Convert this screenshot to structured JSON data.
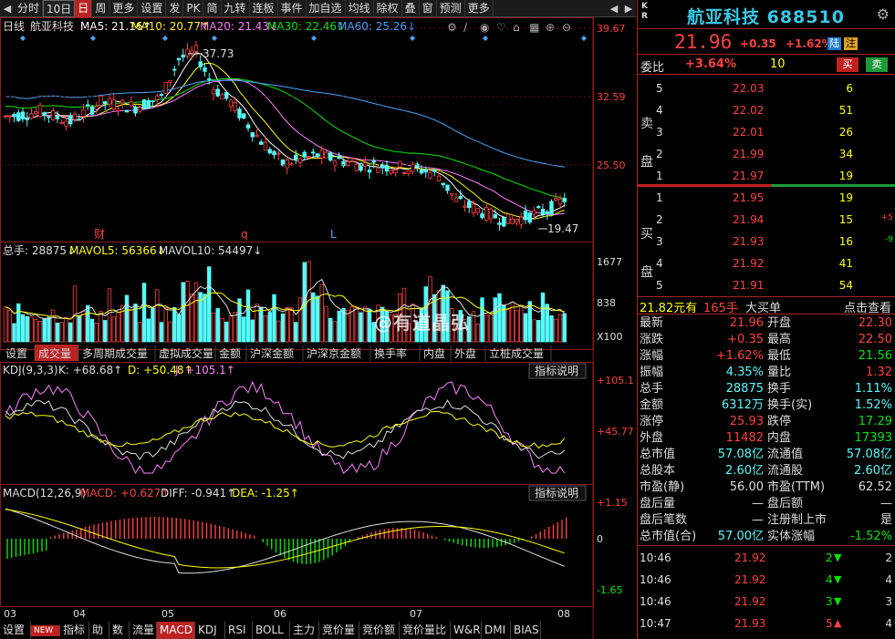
{
  "toolbar": {
    "items": [
      "分时",
      "10日",
      "日",
      "周",
      "更多",
      "设置",
      "发",
      "PK",
      "简",
      "九转",
      "连板",
      "事件",
      "加自选",
      "均线",
      "除权",
      "叠",
      "窗",
      "预测",
      "更多"
    ],
    "active": "日"
  },
  "colors": {
    "up": "#ff4040",
    "down": "#54fcfc",
    "ma5": "#ffffff",
    "ma10": "#ffff00",
    "ma20": "#ff80ff",
    "ma30": "#00e600",
    "ma60": "#4aa3ff",
    "panel_border": "#a22"
  },
  "main_panel": {
    "label": "日线",
    "name": "航亚科技",
    "ma": [
      {
        "t": "MA5: 21.16↑",
        "c": "#ffffff"
      },
      {
        "t": "MA10: 20.77↑",
        "c": "#ffff00"
      },
      {
        "t": "MA20: 21.43↓",
        "c": "#ff80ff"
      },
      {
        "t": "MA30: 22.46↓",
        "c": "#00e600"
      },
      {
        "t": "MA60: 25.26↓",
        "c": "#4aa3ff"
      }
    ],
    "y_labels": [
      "39.67",
      "32.59",
      "25.50"
    ],
    "high_label": "37.73",
    "low_label": "19.47",
    "markers": [
      "财",
      "q",
      "L"
    ]
  },
  "volume_panel": {
    "label": "总手: 28875↓",
    "mav5": "MAVOL5: 56366↓",
    "mav10": "MAVOL10: 54497↓",
    "y_labels": [
      "1677",
      "838",
      "X100"
    ],
    "tabs": [
      "设置",
      "成交量",
      "多周期成交量",
      "虚拟成交量",
      "金额",
      "沪深金额",
      "沪深京金额",
      "换手率",
      "内盘",
      "外盘",
      "立桩成交量"
    ],
    "active_tab": "成交量"
  },
  "kdj_panel": {
    "label": "KDJ(9,3,3)",
    "k": "K: +68.68↑",
    "d": "D: +50.48↑",
    "j": "J: +105.1↑",
    "btn": "指标说明",
    "y_labels": [
      "+105.1",
      "+45.77"
    ]
  },
  "macd_panel": {
    "label": "MACD(12,26,9)",
    "macd": "MACD: +0.627↑",
    "diff": "DIFF: -0.941↑",
    "dea": "DEA: -1.25↑",
    "btn": "指标说明",
    "y_labels": [
      "+1.15",
      "0",
      "-1.65"
    ]
  },
  "x_labels": [
    "03",
    "04",
    "05",
    "06",
    "07",
    "08"
  ],
  "bottom_tabs": [
    "设置",
    "NEW",
    "指标",
    "助",
    "数",
    "流量",
    "MACD",
    "KDJ",
    "RSI",
    "BOLL",
    "主力",
    "竞价量",
    "竞价额",
    "竞价量比",
    "W&R",
    "DMI",
    "BIAS"
  ],
  "bottom_active": "MACD",
  "stock": {
    "kr": "K R",
    "name": "航亚科技 688510",
    "price": "21.96",
    "change": "+0.35",
    "pct": "+1.62%",
    "tag1": "陆",
    "tag2": "注"
  },
  "weibi": {
    "label": "委比",
    "value": "+3.64%",
    "vol": "10",
    "buy": "买",
    "sell": "卖"
  },
  "sell_book": [
    {
      "n": "5",
      "p": "22.03",
      "v": "6"
    },
    {
      "n": "4",
      "p": "22.02",
      "v": "51"
    },
    {
      "n": "3",
      "p": "22.01",
      "v": "26"
    },
    {
      "n": "2",
      "p": "21.99",
      "v": "34"
    },
    {
      "n": "1",
      "p": "21.97",
      "v": "19"
    }
  ],
  "buy_book": [
    {
      "n": "1",
      "p": "21.95",
      "v": "19",
      "d": ""
    },
    {
      "n": "2",
      "p": "21.94",
      "v": "15",
      "d": "+5"
    },
    {
      "n": "3",
      "p": "21.93",
      "v": "16",
      "d": "-9"
    },
    {
      "n": "4",
      "p": "21.92",
      "v": "41",
      "d": ""
    },
    {
      "n": "5",
      "p": "21.91",
      "v": "54",
      "d": ""
    }
  ],
  "sell_label": "卖盘",
  "buy_label": "买盘",
  "big_order": {
    "price": "21.82元有",
    "vol": "165手",
    "text": "大买单",
    "link": "点击查看"
  },
  "stats": [
    {
      "l": "最新",
      "v": "21.96",
      "vc": "#ff4040",
      "l2": "开盘",
      "v2": "22.30",
      "v2c": "#ff4040"
    },
    {
      "l": "涨跌",
      "v": "+0.35",
      "vc": "#ff4040",
      "l2": "最高",
      "v2": "22.50",
      "v2c": "#ff4040"
    },
    {
      "l": "涨幅",
      "v": "+1.62%",
      "vc": "#ff4040",
      "l2": "最低",
      "v2": "21.56",
      "v2c": "#00e600"
    },
    {
      "l": "振幅",
      "v": "4.35%",
      "vc": "#54fcfc",
      "l2": "量比",
      "v2": "1.32",
      "v2c": "#ff4040"
    },
    {
      "l": "总手",
      "v": "28875",
      "vc": "#54fcfc",
      "l2": "换手",
      "v2": "1.11%",
      "v2c": "#54fcfc"
    },
    {
      "l": "金额",
      "v": "6312万",
      "vc": "#54fcfc",
      "l2": "换手(实)",
      "v2": "1.52%",
      "v2c": "#54fcfc"
    },
    {
      "l": "涨停",
      "v": "25.93",
      "vc": "#ff4040",
      "l2": "跌停",
      "v2": "17.29",
      "v2c": "#00e600"
    },
    {
      "l": "外盘",
      "v": "11482",
      "vc": "#ff4040",
      "l2": "内盘",
      "v2": "17393",
      "v2c": "#00e600"
    },
    {
      "l": "总市值",
      "v": "57.08亿",
      "vc": "#54fcfc",
      "l2": "流通值",
      "v2": "57.08亿",
      "v2c": "#54fcfc"
    },
    {
      "l": "总股本",
      "v": "2.60亿",
      "vc": "#54fcfc",
      "l2": "流通股",
      "v2": "2.60亿",
      "v2c": "#54fcfc"
    },
    {
      "l": "市盈(静)",
      "v": "56.00",
      "vc": "#dddddd",
      "l2": "市盈(TTM)",
      "v2": "62.52",
      "v2c": "#dddddd"
    },
    {
      "l": "盘后量",
      "v": "—",
      "vc": "#dddddd",
      "l2": "盘后额",
      "v2": "—",
      "v2c": "#dddddd"
    },
    {
      "l": "盘后笔数",
      "v": "—",
      "vc": "#dddddd",
      "l2": "注册制上市",
      "v2": "是",
      "v2c": "#dddddd"
    },
    {
      "l": "总市值(合)",
      "v": "57.00亿",
      "vc": "#54fcfc",
      "l2": "实体涨幅",
      "v2": "-1.52%",
      "v2c": "#00e600"
    }
  ],
  "trades": [
    {
      "t": "10:46",
      "p": "21.92",
      "v": "2",
      "dir": "down",
      "c": "2"
    },
    {
      "t": "10:46",
      "p": "21.92",
      "v": "4",
      "dir": "down",
      "c": "4"
    },
    {
      "t": "10:46",
      "p": "21.92",
      "v": "3",
      "dir": "down",
      "c": "3"
    },
    {
      "t": "10:47",
      "p": "21.93",
      "v": "5",
      "dir": "up",
      "c": "4"
    }
  ],
  "watermark": "@有道晶弘"
}
